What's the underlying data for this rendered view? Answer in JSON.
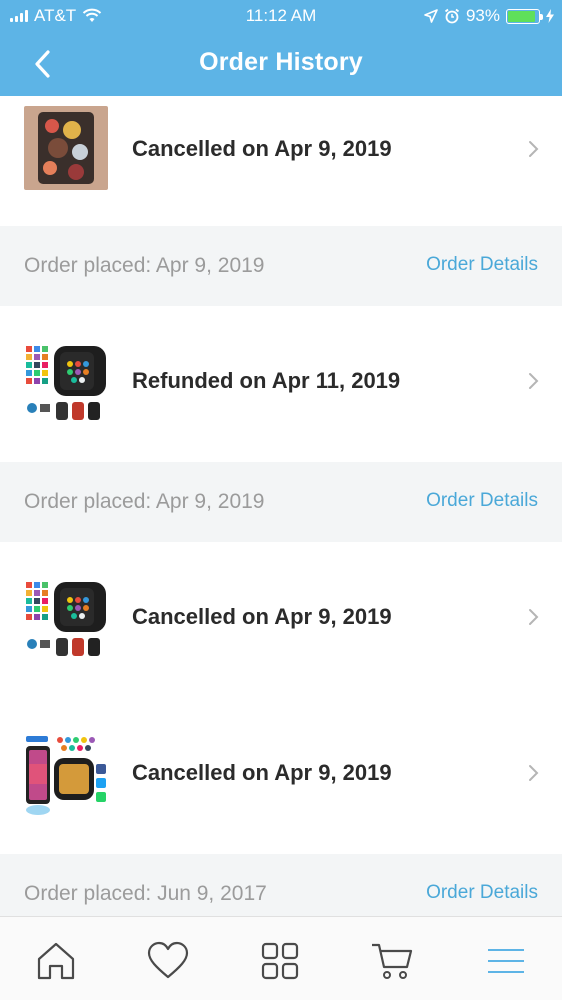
{
  "status_bar": {
    "carrier": "AT&T",
    "time": "11:12 AM",
    "battery": "93%",
    "battery_level": 0.93,
    "icons": [
      "signal-icon",
      "wifi-icon",
      "location-icon",
      "alarm-icon",
      "battery-icon",
      "charging-icon"
    ]
  },
  "nav": {
    "title": "Order History",
    "back_icon": "back-chevron-icon"
  },
  "orders": [
    {
      "status": "Cancelled on Apr 9, 2019",
      "thumbnail": "phone-case-image"
    },
    {
      "status": "Refunded on Apr 11, 2019",
      "thumbnail": "smartwatch-image"
    },
    {
      "status": "Cancelled on Apr 9, 2019",
      "thumbnail": "smartwatch-image"
    },
    {
      "status": "Cancelled on Apr 9, 2019",
      "thumbnail": "bluetooth-smartwatch-image"
    }
  ],
  "order_groups": [
    {
      "placed": "Order placed: Apr 9, 2019",
      "details_label": "Order Details"
    },
    {
      "placed": "Order placed: Apr 9, 2019",
      "details_label": "Order Details"
    },
    {
      "placed": "Order placed: Jun 9, 2017",
      "details_label": "Order Details"
    }
  ],
  "tabbar": {
    "items": [
      "home-icon",
      "heart-icon",
      "grid-icon",
      "cart-icon",
      "menu-icon"
    ],
    "active_color": "#5db4e6"
  },
  "colors": {
    "header": "#5db4e6",
    "link": "#4aa8d8",
    "separator_bg": "#f3f5f6"
  }
}
